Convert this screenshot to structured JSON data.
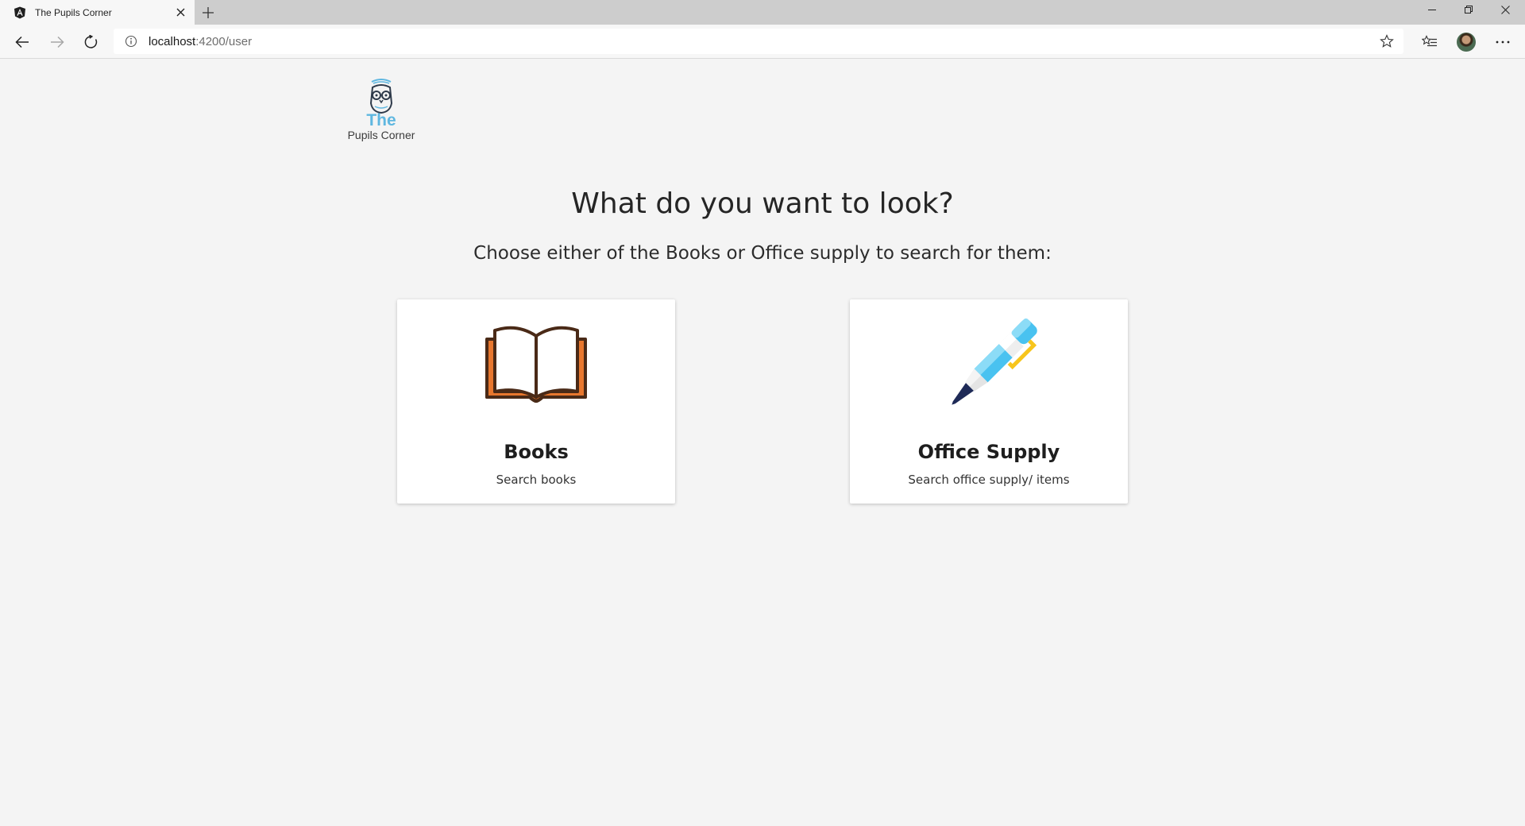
{
  "browser": {
    "tab_title": "The Pupils Corner",
    "url_host": "localhost",
    "url_path": ":4200/user"
  },
  "logo": {
    "line1": "The",
    "line2": "Pupils Corner"
  },
  "main": {
    "headline": "What do you want to look?",
    "subline": "Choose either of the Books or Office supply to search for them:"
  },
  "cards": [
    {
      "title": "Books",
      "text": "Search books",
      "icon": "open-book-icon"
    },
    {
      "title": "Office Supply",
      "text": "Search office supply/ items",
      "icon": "fountain-pen-icon"
    }
  ],
  "colors": {
    "page_bg": "#f4f4f4",
    "logo_accent": "#5fb7e0",
    "book_orange": "#e8772e",
    "book_outline": "#4a2a17",
    "pen_blue": "#49c2f0",
    "pen_yellow": "#f7c51c",
    "pen_nib": "#1e2a57"
  }
}
